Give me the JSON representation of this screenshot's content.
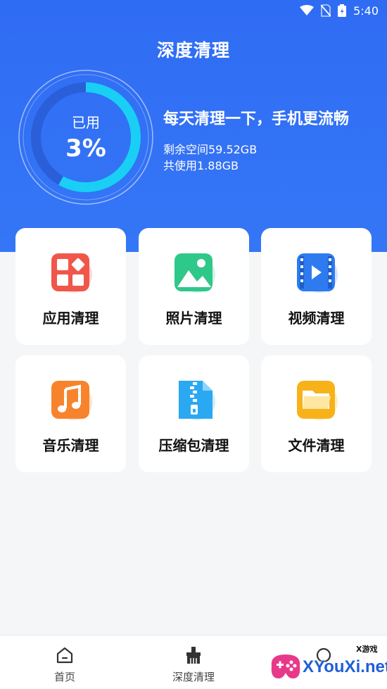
{
  "status_bar": {
    "time": "5:40",
    "icons": [
      "wifi-icon",
      "no-sim-icon",
      "battery-icon"
    ]
  },
  "header": {
    "title": "深度清理",
    "gauge": {
      "label": "已用",
      "value_text": "3%",
      "fraction_used": 0.03
    },
    "slogan": "每天清理一下，手机更流畅",
    "remaining": "剩余空间59.52GB",
    "used": "共使用1.88GB"
  },
  "cards": [
    {
      "label": "应用清理",
      "icon": "app-grid-icon",
      "color": "#f0574a"
    },
    {
      "label": "照片清理",
      "icon": "photo-icon",
      "color": "#2ec88a"
    },
    {
      "label": "视频清理",
      "icon": "video-icon",
      "color": "#2e7bf0"
    },
    {
      "label": "音乐清理",
      "icon": "music-icon",
      "color": "#f7842c"
    },
    {
      "label": "压缩包清理",
      "icon": "zip-icon",
      "color": "#2aa8f2"
    },
    {
      "label": "文件清理",
      "icon": "folder-icon",
      "color": "#f7b219"
    }
  ],
  "tabbar": {
    "tabs": [
      {
        "label": "首页",
        "icon": "home-icon"
      },
      {
        "label": "深度清理",
        "icon": "broom-icon"
      },
      {
        "label": "",
        "icon": "user-icon"
      }
    ]
  },
  "watermark": {
    "text": "XYouXi.net",
    "small": "X游戏"
  },
  "colors": {
    "header_blue": "#3576f6",
    "ring_cyan": "#19d5f7",
    "background": "#f5f6f8"
  }
}
